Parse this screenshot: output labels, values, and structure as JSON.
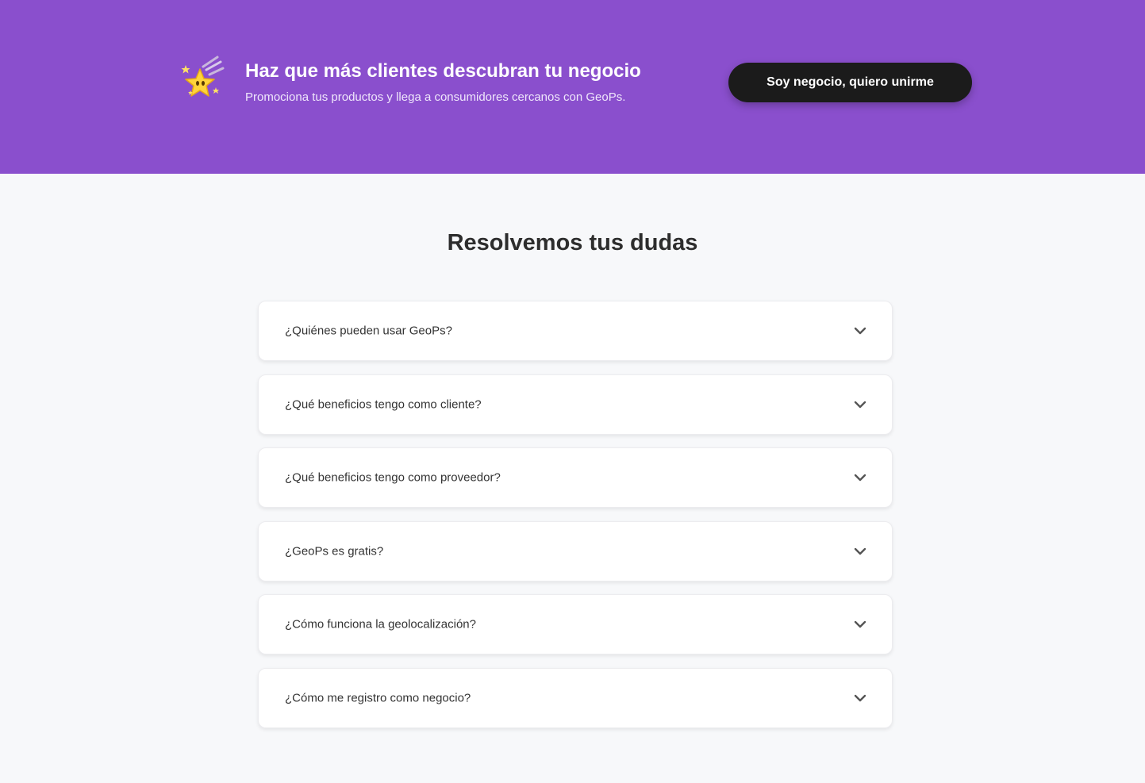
{
  "banner": {
    "title": "Haz que más clientes descubran tu negocio",
    "subtitle": "Promociona tus productos y llega a consumidores cercanos con GeoPs.",
    "cta_label": "Soy negocio, quiero unirme",
    "icon": "shooting-star-icon",
    "background": "#8a4fcd",
    "cta_background": "#1b1b1b"
  },
  "faq": {
    "title": "Resolvemos tus dudas",
    "items": [
      {
        "question": "¿Quiénes pueden usar GeoPs?"
      },
      {
        "question": "¿Qué beneficios tengo como cliente?"
      },
      {
        "question": "¿Qué beneficios tengo como proveedor?"
      },
      {
        "question": "¿GeoPs es gratis?"
      },
      {
        "question": "¿Cómo funciona la geolocalización?"
      },
      {
        "question": "¿Cómo me registro como negocio?"
      }
    ]
  }
}
